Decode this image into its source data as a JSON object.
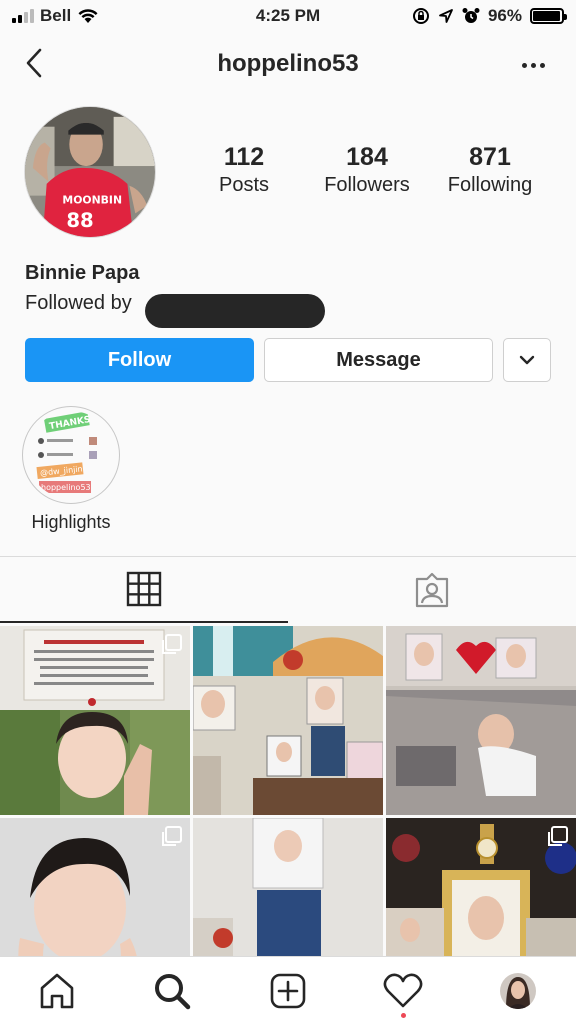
{
  "status_bar": {
    "carrier": "Bell",
    "time": "4:25 PM",
    "battery": "96%",
    "battery_level": 0.96,
    "icons": [
      "signal-icon",
      "wifi-icon",
      "orientation-lock-icon",
      "location-icon",
      "alarm-icon",
      "battery-icon"
    ]
  },
  "header": {
    "username": "hoppelino53",
    "icons": [
      "chevron-left-icon",
      "more-icon"
    ]
  },
  "profile": {
    "stats": [
      {
        "value": "112",
        "label": "Posts"
      },
      {
        "value": "184",
        "label": "Followers"
      },
      {
        "value": "871",
        "label": "Following"
      }
    ],
    "display_name": "Binnie Papa",
    "followed_by": "Followed by",
    "follow_label": "Follow",
    "message_label": "Message"
  },
  "highlights": [
    {
      "label": "Highlights",
      "thumb_text": [
        "THANKS",
        "@dw_jinjin",
        "hoppelino53"
      ]
    }
  ],
  "tabs": [
    "grid-icon",
    "tagged-icon"
  ],
  "nav": [
    "home-icon",
    "search-icon",
    "new-post-icon",
    "heart-icon",
    "profile-avatar"
  ],
  "colors": {
    "accent": "#1a95f5",
    "notification": "#ed4956"
  }
}
